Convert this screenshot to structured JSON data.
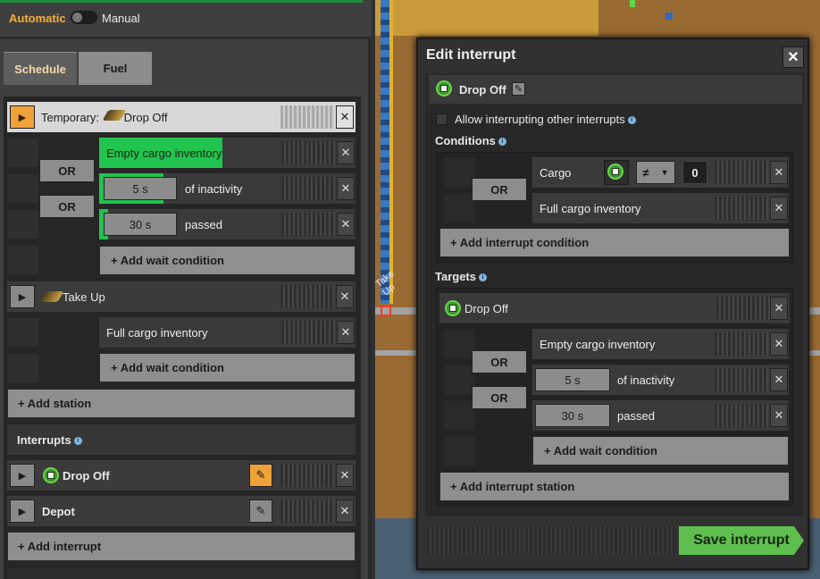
{
  "mode": {
    "automatic": "Automatic",
    "manual": "Manual"
  },
  "tabs": [
    {
      "label": "Schedule"
    },
    {
      "label": "Fuel"
    }
  ],
  "schedule": {
    "stations": [
      {
        "name": "Temporary: ",
        "name2": "Drop Off",
        "active": true,
        "conditions": [
          {
            "label": "Empty cargo inventory"
          },
          {
            "value": "5 s",
            "label": "of inactivity"
          },
          {
            "value": "30 s",
            "label": "passed"
          }
        ],
        "or_labels": [
          "OR",
          "OR"
        ],
        "add_condition": "+ Add wait condition"
      },
      {
        "name": "Take Up",
        "conditions": [
          {
            "label": "Full cargo inventory"
          }
        ],
        "add_condition": "+ Add wait condition"
      }
    ],
    "add_station": "+ Add station",
    "interrupts_label": "Interrupts",
    "interrupts": [
      {
        "name": "Drop Off"
      },
      {
        "name": "Depot"
      }
    ],
    "add_interrupt": "+ Add interrupt"
  },
  "map": {
    "station_label": "Take Up"
  },
  "dialog": {
    "title": "Edit interrupt",
    "close": "✕",
    "interrupt_name": "Drop Off",
    "allow_label": "Allow interrupting other interrupts",
    "conditions_label": "Conditions",
    "conditions": {
      "or_label": "OR",
      "cargo_label": "Cargo",
      "operator": "≠",
      "value": "0",
      "full": "Full cargo inventory",
      "add": "+ Add interrupt condition"
    },
    "targets_label": "Targets",
    "target": {
      "name": "Drop Off",
      "conditions": [
        {
          "label": "Empty cargo inventory"
        },
        {
          "value": "5 s",
          "label": "of inactivity"
        },
        {
          "value": "30 s",
          "label": "passed"
        }
      ],
      "or_labels": [
        "OR",
        "OR"
      ],
      "add_condition": "+ Add wait condition"
    },
    "add_station": "+ Add interrupt station",
    "save": "Save interrupt"
  },
  "colors": {
    "accent": "#f0a23a",
    "progress": "#21c44f",
    "save": "#5fbf4e"
  }
}
